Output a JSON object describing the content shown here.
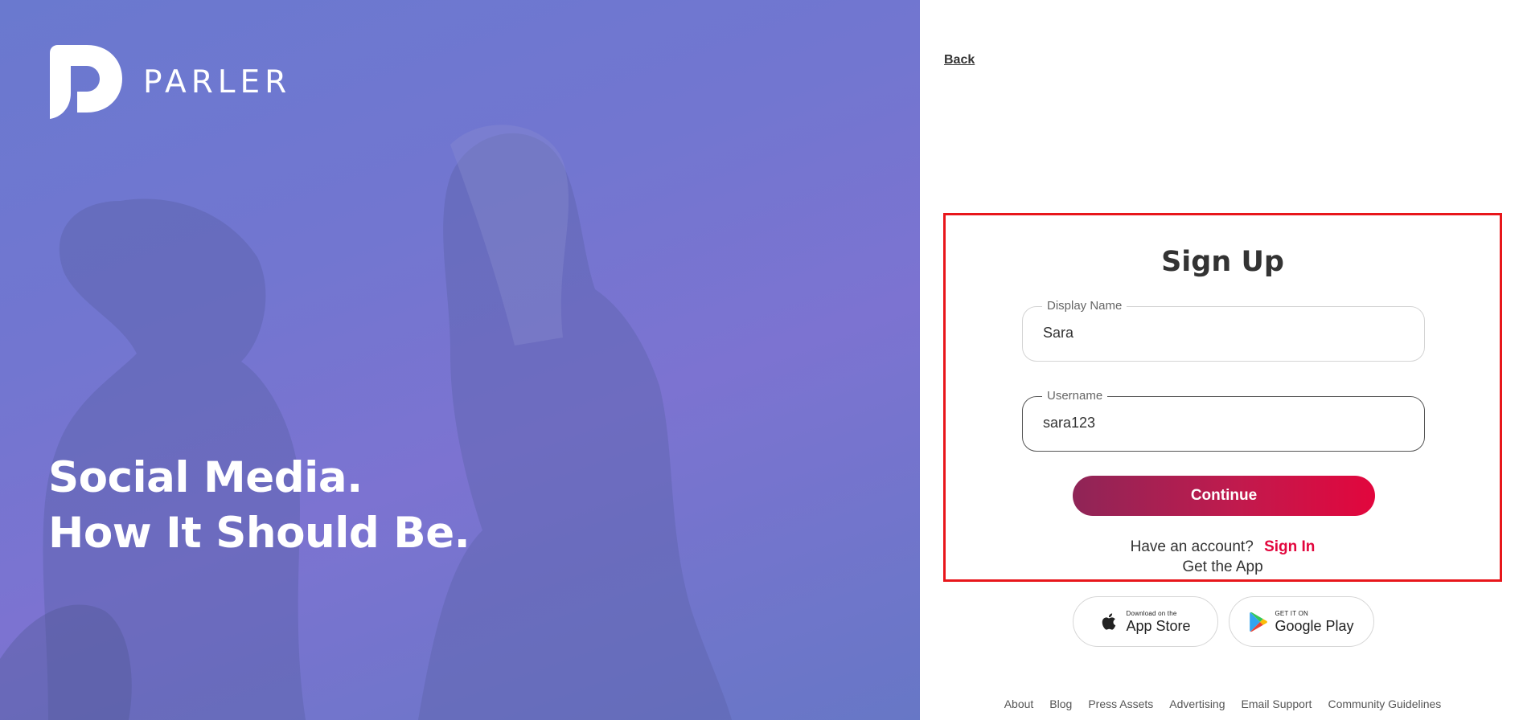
{
  "hero": {
    "brand": "PARLER",
    "headline_line1": "Social Media.",
    "headline_line2": "How It Should Be."
  },
  "nav": {
    "back_label": "Back"
  },
  "signup": {
    "title": "Sign Up",
    "display_name": {
      "label": "Display Name",
      "value": "Sara"
    },
    "username": {
      "label": "Username",
      "value": "sara123"
    },
    "continue_label": "Continue",
    "account_prompt": "Have an account?",
    "signin_label": "Sign In",
    "get_app": "Get the App"
  },
  "stores": {
    "apple": {
      "small": "Download on the",
      "big": "App Store"
    },
    "google": {
      "small": "GET IT ON",
      "big": "Google Play"
    }
  },
  "footer": {
    "links": [
      "About",
      "Blog",
      "Press Assets",
      "Advertising",
      "Email Support",
      "Community Guidelines"
    ]
  },
  "colors": {
    "accent": "#e2063d",
    "accent_dark": "#8f2557",
    "hero_bg": "#7276d0",
    "highlight_border": "#e8161b"
  },
  "icons": [
    "parler-logo-icon",
    "apple-icon",
    "google-play-icon"
  ]
}
